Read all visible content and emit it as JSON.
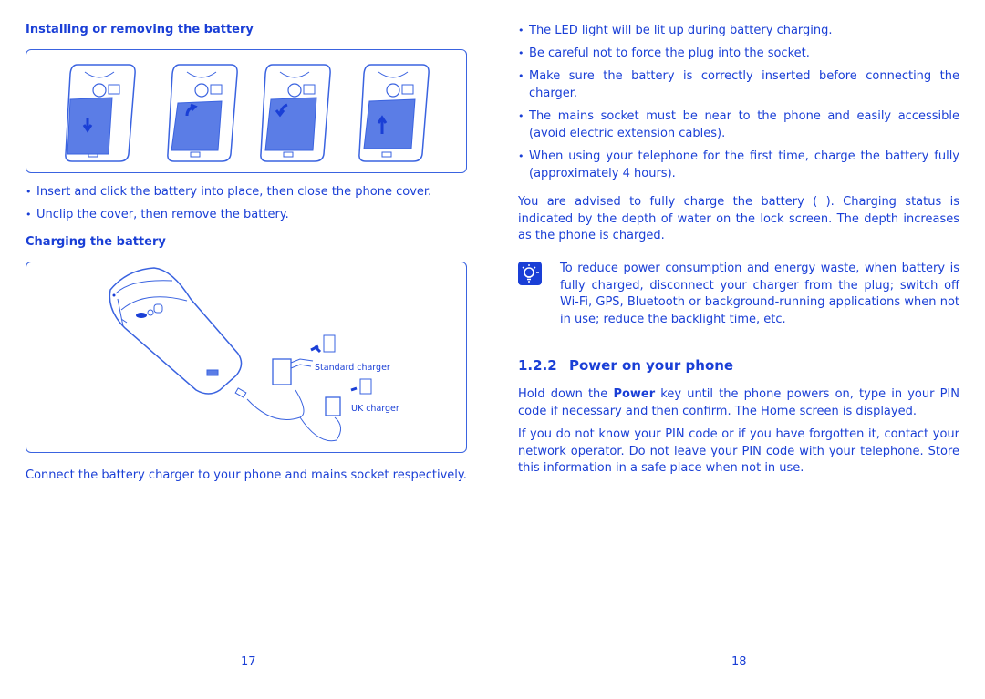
{
  "left_page": {
    "install_heading": "Installing or removing the battery",
    "install_bullets": [
      "Insert and click the battery into place, then close the phone cover.",
      "Unclip the cover, then remove the battery."
    ],
    "charging_heading": "Charging the battery",
    "charger_labels": {
      "standard": "Standard charger",
      "uk": "UK charger"
    },
    "connect_text": "Connect the battery charger to your phone and mains socket respectively.",
    "page_number": "17"
  },
  "right_page": {
    "charging_bullets": [
      "The LED light will be lit up during battery charging.",
      "Be careful not to force the plug into the socket.",
      "Make sure the battery is correctly inserted before connecting the charger.",
      "The mains socket must be near to the phone and easily accessible (avoid electric extension cables).",
      "When using your telephone for the first time, charge the battery fully (approximately 4 hours)."
    ],
    "advice_text": "You are advised to fully charge the battery (    ). Charging status is indicated by the depth of water on the lock screen. The depth increases as the phone is charged.",
    "tip_text": "To reduce power consumption and energy waste, when battery is fully charged, disconnect your charger from the plug; switch off Wi-Fi, GPS, Bluetooth or background-running applications when not in use; reduce the backlight time, etc.",
    "section": {
      "number": "1.2.2",
      "title": "Power on your phone"
    },
    "power_para_pre": "Hold down the ",
    "power_para_bold": "Power",
    "power_para_post": " key until the phone powers on, type in your PIN code if necessary and then confirm. The Home screen is displayed.",
    "pin_para": "If you do not know your PIN code or if you have forgotten it, contact your network operator. Do not leave your PIN code with your telephone. Store this information in a safe place when not in use.",
    "page_number": "18"
  },
  "colors": {
    "text": "#1a3fd6",
    "battery_fill": "#5b7de6",
    "frame": "#3a63e0"
  }
}
